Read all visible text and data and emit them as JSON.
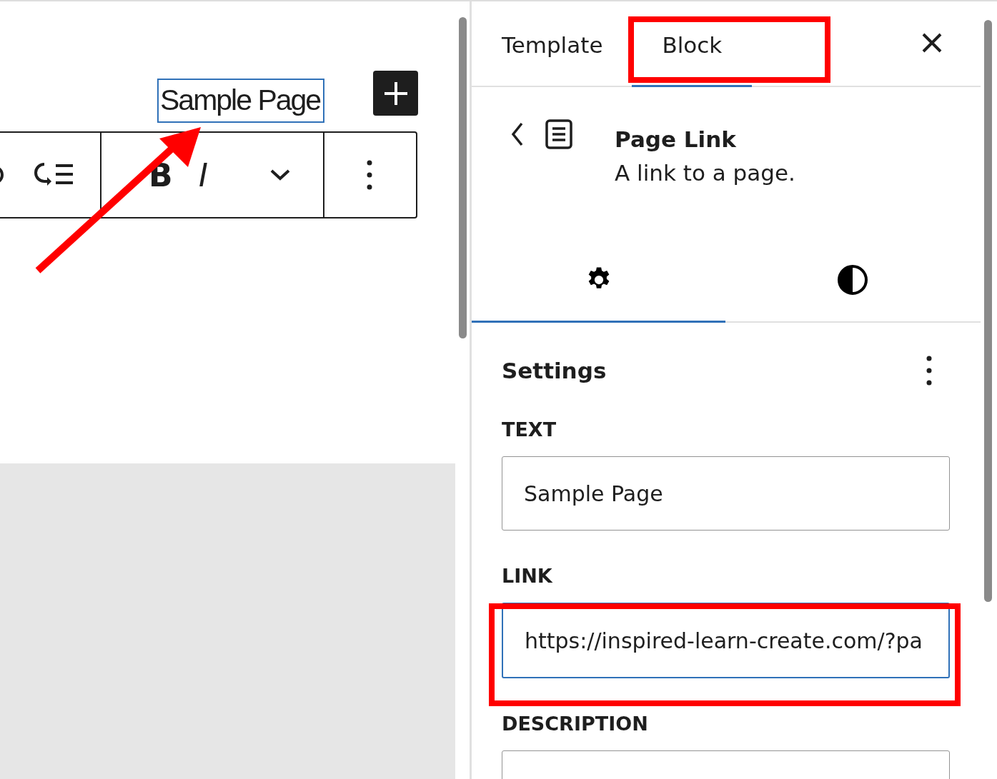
{
  "canvas": {
    "selected_text": "Sample Page",
    "toolbar": [
      {
        "kind": "partial-icon"
      },
      {
        "kind": "list-icon"
      },
      {
        "kind": "divider"
      },
      {
        "kind": "bold",
        "label": "B"
      },
      {
        "kind": "italic",
        "label": "I"
      },
      {
        "kind": "chevron-icon"
      },
      {
        "kind": "divider"
      },
      {
        "kind": "more-icon"
      }
    ]
  },
  "sidebar": {
    "tabs": [
      {
        "label": "Template",
        "selected": false
      },
      {
        "label": "Block",
        "selected": true
      }
    ],
    "block": {
      "title": "Page Link",
      "description": "A link to a page."
    },
    "panel_tabs": [
      {
        "kind": "settings",
        "selected": true
      },
      {
        "kind": "styles",
        "selected": false
      }
    ],
    "section_title": "Settings",
    "fields": [
      {
        "label": "TEXT",
        "value": "Sample Page",
        "focused": false
      },
      {
        "label": "LINK",
        "value": "https://inspired-learn-create.com/?pa",
        "focused": true
      },
      {
        "label": "DESCRIPTION",
        "focused": false
      }
    ]
  },
  "annotations": [
    {
      "kind": "tab-frame"
    },
    {
      "kind": "field-frame"
    },
    {
      "kind": "arrow"
    }
  ]
}
